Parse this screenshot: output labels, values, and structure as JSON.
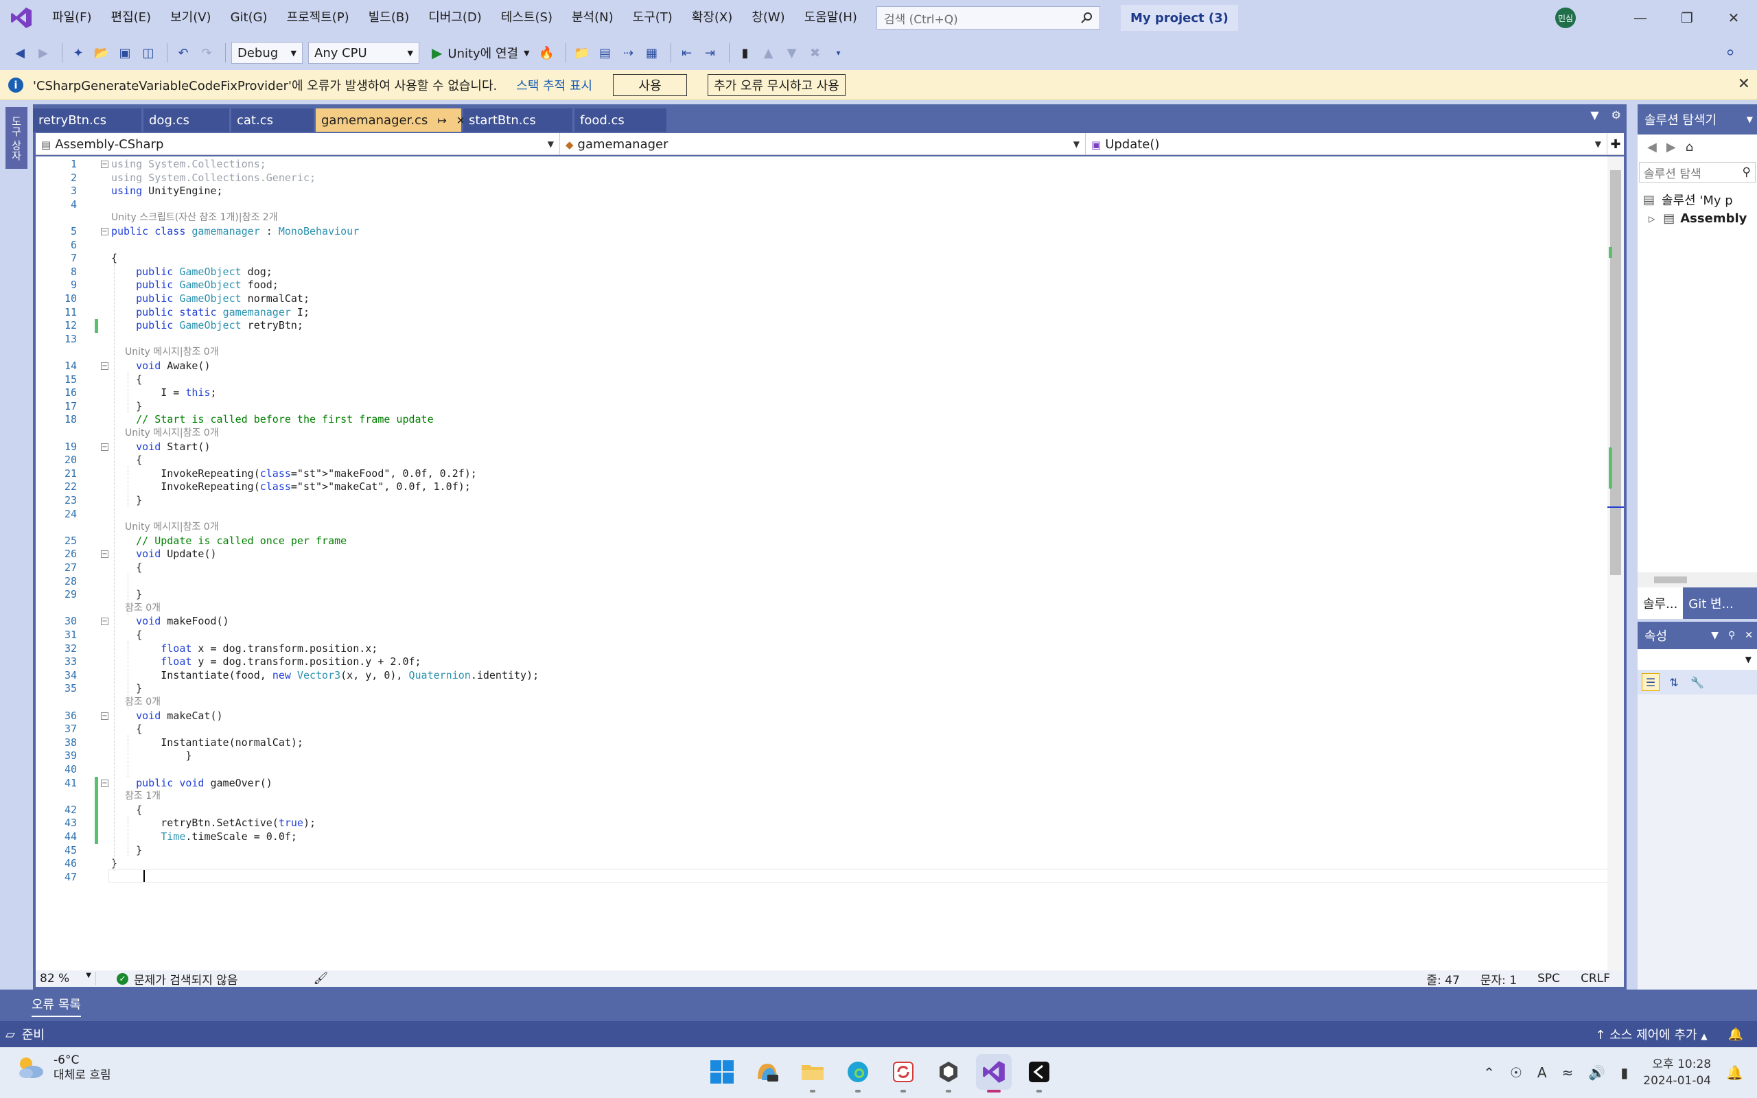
{
  "menubar": {
    "items": [
      "파일(F)",
      "편집(E)",
      "보기(V)",
      "Git(G)",
      "프로젝트(P)",
      "빌드(B)",
      "디버그(D)",
      "테스트(S)",
      "분석(N)",
      "도구(T)",
      "확장(X)",
      "창(W)",
      "도움말(H)"
    ],
    "search_placeholder": "검색 (Ctrl+Q)",
    "project_name": "My project (3)",
    "avatar_initials": "민심"
  },
  "toolbar": {
    "config": "Debug",
    "platform": "Any CPU",
    "run_label": "Unity에 연결"
  },
  "infobar": {
    "message": "'CSharpGenerateVariableCodeFixProvider'에 오류가 발생하여 사용할 수 없습니다.",
    "link": "스택 추적 표시",
    "enable_button": "사용",
    "ignore_button": "추가 오류 무시하고 사용"
  },
  "left_strip": {
    "toolbox_label": "도구 상자"
  },
  "tabs": [
    "retryBtn.cs",
    "dog.cs",
    "cat.cs",
    "gamemanager.cs",
    "startBtn.cs",
    "food.cs"
  ],
  "active_tab": "gamemanager.cs",
  "navbar": {
    "project": "Assembly-CSharp",
    "type": "gamemanager",
    "member": "Update()"
  },
  "lens": {
    "class": "Unity 스크립트(자산 참조 1개)|참조 2개",
    "message": "Unity 메시지|참조 0개",
    "ref0": "참조 0개",
    "ref1": "참조 1개"
  },
  "code_lines": [
    "using System.Collections;",
    "using System.Collections.Generic;",
    "using UnityEngine;",
    "",
    "public class gamemanager : MonoBehaviour",
    "",
    "{",
    "    public GameObject dog;",
    "    public GameObject food;",
    "    public GameObject normalCat;",
    "    public static gamemanager I;",
    "    public GameObject retryBtn;",
    "",
    "    void Awake()",
    "    {",
    "        I = this;",
    "    }",
    "    // Start is called before the first frame update",
    "    void Start()",
    "    {",
    "        InvokeRepeating(\"makeFood\", 0.0f, 0.2f);",
    "        InvokeRepeating(\"makeCat\", 0.0f, 1.0f);",
    "    }",
    "",
    "    // Update is called once per frame",
    "    void Update()",
    "    {",
    "",
    "    }",
    "    void makeFood()",
    "    {",
    "        float x = dog.transform.position.x;",
    "        float y = dog.transform.position.y + 2.0f;",
    "        Instantiate(food, new Vector3(x, y, 0), Quaternion.identity);",
    "    }",
    "    void makeCat()",
    "    {",
    "        Instantiate(normalCat);",
    "            }",
    "",
    "    public void gameOver()",
    "    {",
    "        retryBtn.SetActive(true);",
    "        Time.timeScale = 0.0f;",
    "    }",
    "}",
    ""
  ],
  "editor_status": {
    "zoom": "82 %",
    "issues": "문제가 검색되지 않음",
    "line": "줄: 47",
    "char": "문자: 1",
    "whitespace": "SPC",
    "line_ending": "CRLF"
  },
  "errorlist_tab": "오류 목록",
  "solution_explorer": {
    "title": "솔루션 탐색기",
    "search_placeholder": "솔루션 탐색",
    "solution_node": "솔루션 'My p",
    "project_node": "Assembly",
    "tab_solution": "솔루...",
    "tab_git": "Git 변..."
  },
  "properties": {
    "title": "속성"
  },
  "statusbar": {
    "ready": "준비",
    "source_control": "소스 제어에 추가"
  },
  "taskbar": {
    "temperature": "-6°C",
    "weather": "대체로 흐림",
    "time": "오후 10:28",
    "date": "2024-01-04",
    "ime": "A"
  }
}
